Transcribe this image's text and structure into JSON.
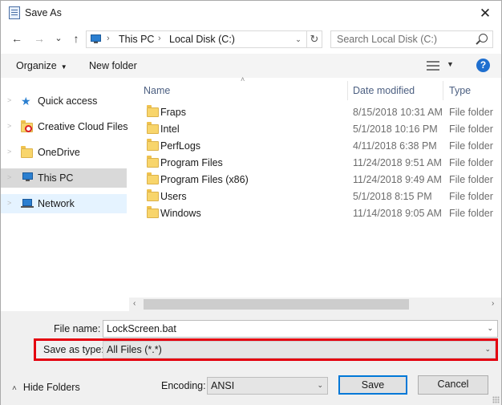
{
  "window": {
    "title": "Save As",
    "close_glyph": "✕"
  },
  "nav": {
    "back_glyph": "←",
    "forward_glyph": "→",
    "recent_glyph": "⌄",
    "up_glyph": "↑"
  },
  "address": {
    "icon": "pc-icon",
    "crumbs": [
      "This PC",
      "Local Disk (C:)"
    ],
    "separator": "›",
    "dropdown_glyph": "⌄",
    "refresh_glyph": "↻"
  },
  "search": {
    "placeholder": "Search Local Disk (C:)"
  },
  "toolbar": {
    "organize_label": "Organize",
    "organize_arrow": "▼",
    "new_folder_label": "New folder",
    "view_arrow": "▼",
    "help_glyph": "?"
  },
  "sidebar": {
    "items": [
      {
        "label": "Quick access",
        "icon": "star-icon",
        "state": "normal"
      },
      {
        "label": "Creative Cloud Files",
        "icon": "creative-cloud-folder-icon",
        "state": "normal"
      },
      {
        "label": "OneDrive",
        "icon": "folder-icon",
        "state": "normal"
      },
      {
        "label": "This PC",
        "icon": "pc-icon",
        "state": "selected"
      },
      {
        "label": "Network",
        "icon": "network-icon",
        "state": "hover"
      }
    ]
  },
  "list": {
    "sort_glyph": "˄",
    "columns": [
      "Name",
      "Date modified",
      "Type"
    ],
    "rows": [
      {
        "name": "Fraps",
        "date": "8/15/2018 10:31 AM",
        "type": "File folder"
      },
      {
        "name": "Intel",
        "date": "5/1/2018 10:16 PM",
        "type": "File folder"
      },
      {
        "name": "PerfLogs",
        "date": "4/11/2018 6:38 PM",
        "type": "File folder"
      },
      {
        "name": "Program Files",
        "date": "11/24/2018 9:51 AM",
        "type": "File folder"
      },
      {
        "name": "Program Files (x86)",
        "date": "11/24/2018 9:49 AM",
        "type": "File folder"
      },
      {
        "name": "Users",
        "date": "5/1/2018 8:15 PM",
        "type": "File folder"
      },
      {
        "name": "Windows",
        "date": "11/14/2018 9:05 AM",
        "type": "File folder"
      }
    ]
  },
  "scrollbar": {
    "left_glyph": "‹",
    "right_glyph": "›"
  },
  "form": {
    "file_name_label": "File name:",
    "file_name_value": "LockScreen.bat",
    "save_type_label": "Save as type:",
    "save_type_value": "All Files  (*.*)",
    "encoding_label": "Encoding:",
    "encoding_value": "ANSI",
    "dropdown_glyph": "⌄",
    "highlight_color": "#e4000f"
  },
  "footer": {
    "hide_folders_label": "Hide Folders",
    "hide_folders_glyph": "˄",
    "save_label": "Save",
    "cancel_label": "Cancel"
  },
  "colors": {
    "accent": "#0078d7",
    "folder": "#f8d56b",
    "selection": "#d9d9d9",
    "hover": "#e5f3ff"
  }
}
